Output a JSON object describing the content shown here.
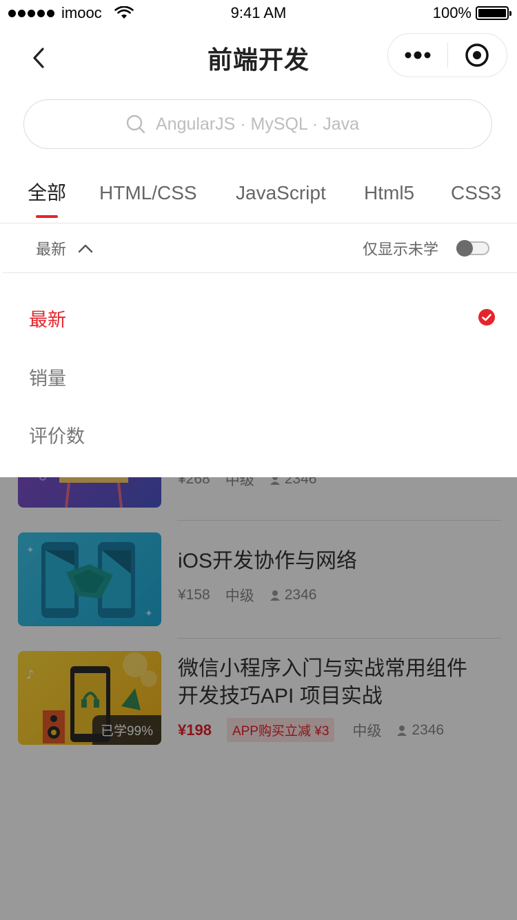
{
  "status": {
    "carrier": "imooc",
    "time": "9:41 AM",
    "battery": "100%"
  },
  "nav": {
    "title": "前端开发",
    "back_icon": "chevron-left-icon",
    "more_icon": "more-dots-icon",
    "close_icon": "target-circle-icon"
  },
  "search": {
    "placeholder": "AngularJS · MySQL · Java"
  },
  "tabs": [
    {
      "label": "全部",
      "active": true
    },
    {
      "label": "HTML/CSS",
      "active": false
    },
    {
      "label": "JavaScript",
      "active": false
    },
    {
      "label": "Html5",
      "active": false
    },
    {
      "label": "CSS3",
      "active": false
    }
  ],
  "sort_bar": {
    "current": "最新",
    "toggle_label": "仅显示未学",
    "toggle_on": false
  },
  "sort_options": [
    {
      "label": "最新",
      "selected": true
    },
    {
      "label": "销量",
      "selected": false
    },
    {
      "label": "评价数",
      "selected": false
    }
  ],
  "courses": [
    {
      "title": "",
      "price": "¥268",
      "level": "中级",
      "students": "2346"
    },
    {
      "title": "iOS开发协作与网络",
      "price": "¥158",
      "level": "中级",
      "students": "2346"
    },
    {
      "title_line1": "微信小程序入门与实战常用组件",
      "title_line2": "开发技巧API  项目实战",
      "price": "¥198",
      "promo": "APP购买立减 ¥3",
      "level": "中级",
      "students": "2346",
      "progress": "已学99%"
    }
  ],
  "colors": {
    "accent": "#e5242b",
    "promo_bg": "#fde4e5"
  }
}
